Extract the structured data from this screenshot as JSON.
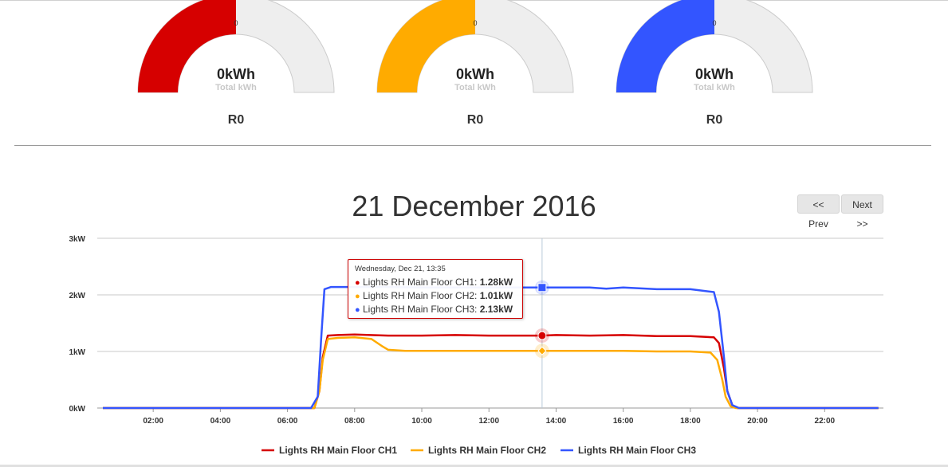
{
  "gauges": [
    {
      "value": "0kWh",
      "sub": "Total kWh",
      "tick": "0",
      "cost": "R0",
      "color": "#d60000",
      "fraction": 0.5
    },
    {
      "value": "0kWh",
      "sub": "Total kWh",
      "tick": "0",
      "cost": "R0",
      "color": "#ffab00",
      "fraction": 0.5
    },
    {
      "value": "0kWh",
      "sub": "Total kWh",
      "tick": "0",
      "cost": "R0",
      "color": "#3355ff",
      "fraction": 0.5
    }
  ],
  "header": {
    "title": "21 December 2016",
    "prev_label": "<< Prev",
    "next_label": "Next >>"
  },
  "tooltip": {
    "heading": "Wednesday, Dec 21, 13:35",
    "rows": [
      {
        "label": "Lights RH Main Floor CH1: ",
        "value": "1.28kW",
        "color": "#d60000"
      },
      {
        "label": "Lights RH Main Floor CH2: ",
        "value": "1.01kW",
        "color": "#ffab00"
      },
      {
        "label": "Lights RH Main Floor CH3: ",
        "value": "2.13kW",
        "color": "#3355ff"
      }
    ]
  },
  "chart_data": {
    "type": "line",
    "title": "21 December 2016",
    "xlabel": "",
    "ylabel": "",
    "x_ticks": [
      "02:00",
      "04:00",
      "06:00",
      "08:00",
      "10:00",
      "12:00",
      "14:00",
      "16:00",
      "18:00",
      "20:00",
      "22:00"
    ],
    "y_ticks": [
      "0kW",
      "1kW",
      "2kW",
      "3kW"
    ],
    "xlim": [
      0.5,
      23.75
    ],
    "ylim": [
      0,
      3
    ],
    "grid": true,
    "legend": "bottom",
    "crosshair_hour": 13.583,
    "series": [
      {
        "name": "Lights RH Main Floor CH1",
        "color": "#d60000",
        "x": [
          0.5,
          6.8,
          6.95,
          7.05,
          7.2,
          7.5,
          8,
          9,
          10,
          11,
          12,
          13,
          13.58,
          14,
          15,
          16,
          17,
          18,
          18.7,
          18.85,
          19,
          19.1,
          19.25,
          19.4,
          20,
          23.6
        ],
        "y": [
          0,
          0,
          0.3,
          0.9,
          1.28,
          1.29,
          1.3,
          1.28,
          1.28,
          1.29,
          1.28,
          1.28,
          1.28,
          1.29,
          1.28,
          1.29,
          1.27,
          1.27,
          1.25,
          1.15,
          0.7,
          0.3,
          0.05,
          0,
          0,
          0
        ]
      },
      {
        "name": "Lights RH Main Floor CH2",
        "color": "#ffab00",
        "x": [
          0.5,
          6.8,
          6.95,
          7.05,
          7.2,
          7.5,
          8,
          8.5,
          8.8,
          9,
          9.5,
          10,
          11,
          12,
          13,
          13.58,
          14,
          15,
          16,
          17,
          18,
          18.6,
          18.8,
          18.95,
          19.05,
          19.2,
          19.35,
          20,
          23.6
        ],
        "y": [
          0,
          0,
          0.3,
          0.85,
          1.22,
          1.24,
          1.25,
          1.22,
          1.1,
          1.03,
          1.01,
          1.01,
          1.01,
          1.01,
          1.01,
          1.01,
          1.01,
          1.01,
          1.01,
          1.0,
          1.0,
          0.98,
          0.85,
          0.5,
          0.2,
          0.03,
          0,
          0,
          0
        ]
      },
      {
        "name": "Lights RH Main Floor CH3",
        "color": "#3355ff",
        "x": [
          0.5,
          6.7,
          6.9,
          7.0,
          7.1,
          7.3,
          8,
          9,
          10,
          11,
          12,
          13,
          13.58,
          14,
          15,
          15.5,
          16,
          17,
          18,
          18.7,
          18.85,
          19.0,
          19.1,
          19.25,
          19.45,
          20,
          23.6
        ],
        "y": [
          0,
          0,
          0.2,
          1.2,
          2.1,
          2.14,
          2.14,
          2.14,
          2.13,
          2.13,
          2.13,
          2.13,
          2.13,
          2.13,
          2.13,
          2.11,
          2.13,
          2.1,
          2.1,
          2.05,
          1.7,
          0.9,
          0.3,
          0.05,
          0,
          0,
          0
        ]
      }
    ]
  }
}
